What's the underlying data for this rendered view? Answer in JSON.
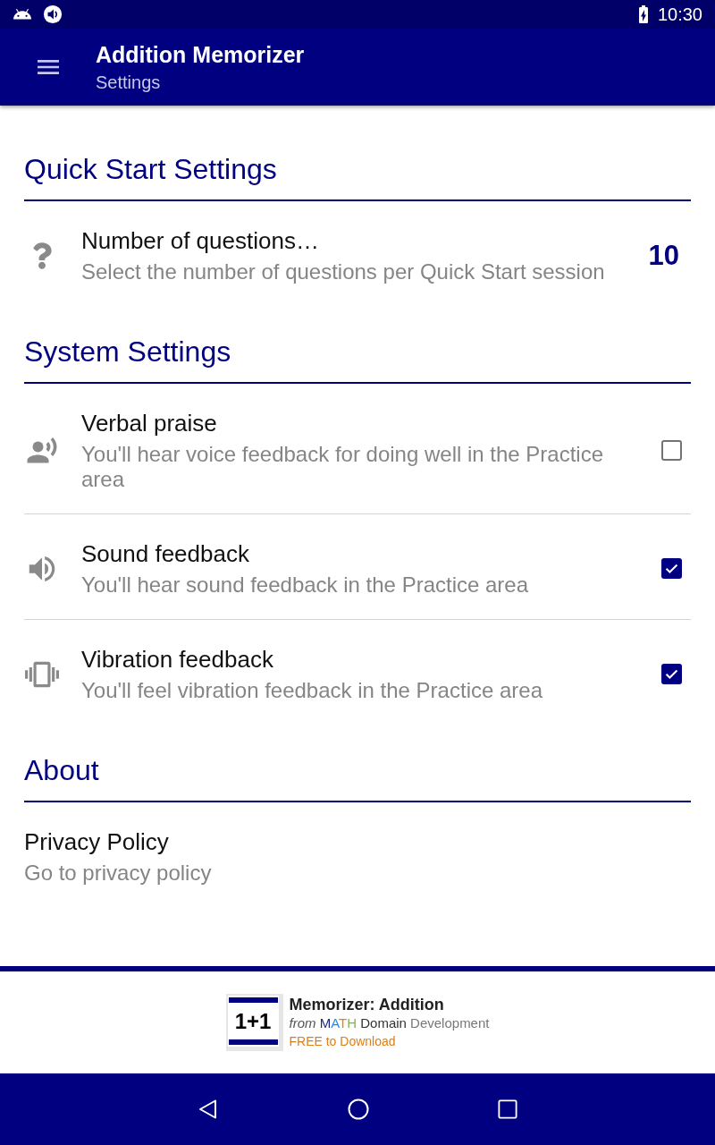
{
  "status_bar": {
    "time": "10:30"
  },
  "app_bar": {
    "title": "Addition Memorizer",
    "subtitle": "Settings"
  },
  "sections": [
    {
      "title": "Quick Start Settings",
      "items": [
        {
          "kind": "value",
          "title": "Number of questions…",
          "summary": "Select the number of questions per Quick Start session",
          "value": "10"
        }
      ]
    },
    {
      "title": "System Settings",
      "items": [
        {
          "kind": "checkbox",
          "title": "Verbal praise",
          "summary": "You'll hear voice feedback for doing well in the Practice area",
          "checked": false
        },
        {
          "kind": "checkbox",
          "title": "Sound feedback",
          "summary": "You'll hear sound feedback in the Practice area",
          "checked": true
        },
        {
          "kind": "checkbox",
          "title": "Vibration feedback",
          "summary": "You'll feel vibration feedback in the Practice area",
          "checked": true
        }
      ]
    },
    {
      "title": "About",
      "items": [
        {
          "kind": "link",
          "title": "Privacy Policy",
          "summary": "Go to privacy policy"
        }
      ]
    }
  ],
  "ad": {
    "logo_text": "1+1",
    "title": "Memorizer: Addition",
    "byline": {
      "prefix": "from",
      "brand_mark": "MATH",
      "brand_name": "Domain",
      "brand_suffix": "Development"
    },
    "tagline": "FREE to Download"
  }
}
